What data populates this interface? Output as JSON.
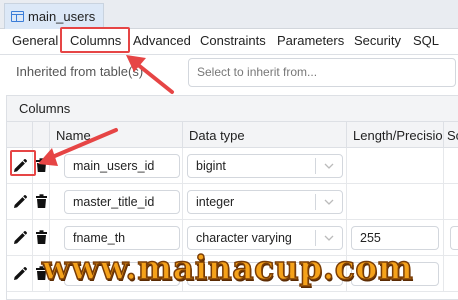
{
  "title_tab": {
    "label": "main_users",
    "icon": "table-icon"
  },
  "tabs": [
    {
      "label": "General"
    },
    {
      "label": "Columns",
      "active": true
    },
    {
      "label": "Advanced"
    },
    {
      "label": "Constraints"
    },
    {
      "label": "Parameters"
    },
    {
      "label": "Security"
    },
    {
      "label": "SQL"
    }
  ],
  "inherit": {
    "label": "Inherited from table(s)",
    "placeholder": "Select to inherit from..."
  },
  "grid": {
    "title": "Columns",
    "headers": {
      "name": "Name",
      "data_type": "Data type",
      "length": "Length/Precision",
      "scale_partial": "Sc"
    },
    "rows": [
      {
        "name": "main_users_id",
        "data_type": "bigint",
        "length": ""
      },
      {
        "name": "master_title_id",
        "data_type": "integer",
        "length": ""
      },
      {
        "name": "fname_th",
        "data_type": "character varying",
        "length": "255"
      },
      {
        "name": "",
        "data_type": "",
        "length": ""
      }
    ]
  },
  "annotation_colors": {
    "highlight": "#e64545",
    "watermark": "#f5a21a"
  },
  "watermark": {
    "text": "www.mainacup.com"
  }
}
